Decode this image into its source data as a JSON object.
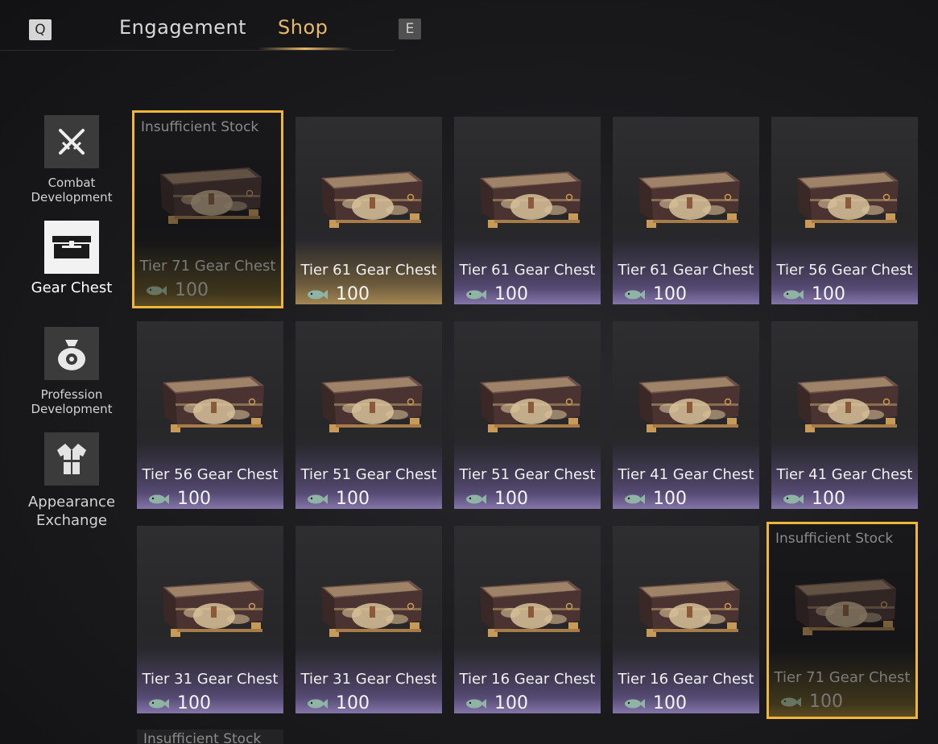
{
  "tabs": {
    "prev_key": "Q",
    "next_key": "E",
    "items": [
      {
        "label": "Engagement"
      },
      {
        "label": "Shop"
      }
    ]
  },
  "sidebar": {
    "items": [
      {
        "label": "Combat\nDevelopment",
        "icon": "crossed-swords-icon"
      },
      {
        "label": "Gear Chest",
        "icon": "chest-icon"
      },
      {
        "label": "Profession\nDevelopment",
        "icon": "money-bag-icon"
      },
      {
        "label": "Appearance\nExchange",
        "icon": "robe-icon"
      }
    ]
  },
  "shop": {
    "currency_icon": "fish-icon",
    "insufficient_label": "Insufficient Stock",
    "items": [
      {
        "name": "Tier 71 Gear Chest",
        "price": "100"
      },
      {
        "name": "Tier 61 Gear Chest",
        "price": "100"
      },
      {
        "name": "Tier 61 Gear Chest",
        "price": "100"
      },
      {
        "name": "Tier 61 Gear Chest",
        "price": "100"
      },
      {
        "name": "Tier 56 Gear Chest",
        "price": "100"
      },
      {
        "name": "Tier 56 Gear Chest",
        "price": "100"
      },
      {
        "name": "Tier 51 Gear Chest",
        "price": "100"
      },
      {
        "name": "Tier 51 Gear Chest",
        "price": "100"
      },
      {
        "name": "Tier 41 Gear Chest",
        "price": "100"
      },
      {
        "name": "Tier 41 Gear Chest",
        "price": "100"
      },
      {
        "name": "Tier 31 Gear Chest",
        "price": "100"
      },
      {
        "name": "Tier 31 Gear Chest",
        "price": "100"
      },
      {
        "name": "Tier 16 Gear Chest",
        "price": "100"
      },
      {
        "name": "Tier 16 Gear Chest",
        "price": "100"
      },
      {
        "name": "Tier 71 Gear Chest",
        "price": "100"
      }
    ]
  },
  "colors": {
    "accent_gold": "#efb63c",
    "tab_active": "#e7b76a",
    "card_glow_purple": "#9a84d6"
  }
}
